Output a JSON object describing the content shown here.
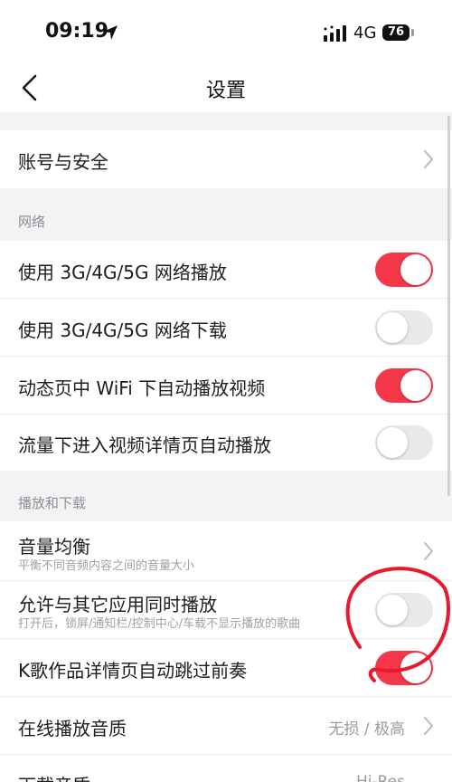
{
  "status_bar": {
    "time": "09:19",
    "network": "4G",
    "battery": "76"
  },
  "nav": {
    "title": "设置"
  },
  "account_row": {
    "label": "账号与安全"
  },
  "section_network": {
    "title": "网络",
    "items": [
      {
        "label": "使用 3G/4G/5G 网络播放",
        "toggle": "on"
      },
      {
        "label": "使用 3G/4G/5G 网络下载",
        "toggle": "off"
      },
      {
        "label": "动态页中 WiFi 下自动播放视频",
        "toggle": "on"
      },
      {
        "label": "流量下进入视频详情页自动播放",
        "toggle": "off"
      }
    ]
  },
  "section_play": {
    "title": "播放和下载",
    "items": [
      {
        "label": "音量均衡",
        "sub": "平衡不同音频内容之间的音量大小"
      },
      {
        "label": "允许与其它应用同时播放",
        "sub": "打开后，锁屏/通知栏/控制中心/车载不显示播放的歌曲",
        "toggle": "off"
      },
      {
        "label": "K歌作品详情页自动跳过前奏",
        "toggle": "on"
      },
      {
        "label": "在线播放音质",
        "value": "无损 / 极高"
      },
      {
        "label": "下载音质",
        "value": "Hi-Res"
      }
    ]
  },
  "colors": {
    "accent": "#f5374a",
    "annotation": "#e8192c"
  }
}
